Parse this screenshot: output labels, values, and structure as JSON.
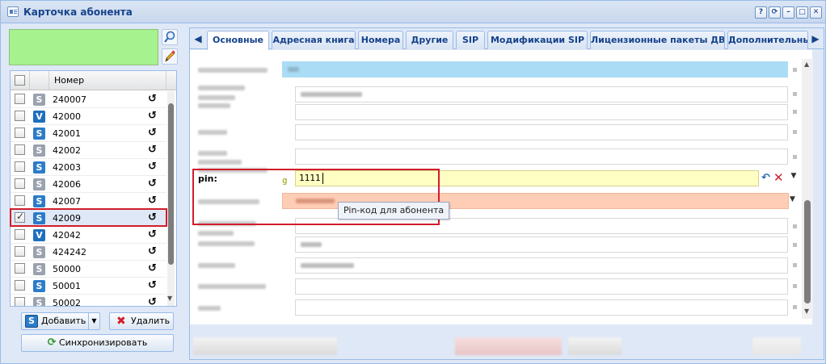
{
  "window": {
    "title": "Карточка абонента",
    "tools": [
      "?",
      "⟳",
      "–",
      "□",
      "✕"
    ]
  },
  "grid": {
    "header": "Номер",
    "rows": [
      {
        "type": "S",
        "number": "240007",
        "checked": false,
        "selected": false
      },
      {
        "type": "V",
        "number": "42000",
        "checked": false,
        "selected": false
      },
      {
        "type": "Sb",
        "number": "42001",
        "checked": false,
        "selected": false
      },
      {
        "type": "S",
        "number": "42002",
        "checked": false,
        "selected": false
      },
      {
        "type": "Sb",
        "number": "42003",
        "checked": false,
        "selected": false
      },
      {
        "type": "S",
        "number": "42006",
        "checked": false,
        "selected": false
      },
      {
        "type": "Sb",
        "number": "42007",
        "checked": false,
        "selected": false
      },
      {
        "type": "Sb",
        "number": "42009",
        "checked": true,
        "selected": true
      },
      {
        "type": "V",
        "number": "42042",
        "checked": false,
        "selected": false
      },
      {
        "type": "S",
        "number": "424242",
        "checked": false,
        "selected": false
      },
      {
        "type": "S",
        "number": "50000",
        "checked": false,
        "selected": false
      },
      {
        "type": "Sb",
        "number": "50001",
        "checked": false,
        "selected": false
      },
      {
        "type": "S",
        "number": "50002",
        "checked": false,
        "selected": false
      }
    ],
    "badge_letters": {
      "S": "S",
      "Sb": "S",
      "V": "V"
    }
  },
  "buttons": {
    "add": "Добавить",
    "delete": "Удалить",
    "sync": "Синхронизировать"
  },
  "tabs": [
    "Основные",
    "Адресная книга",
    "Номера",
    "Другие",
    "SIP",
    "Модификации SIP",
    "Лицензионные пакеты ДВО",
    "Дополнительны"
  ],
  "pin": {
    "label": "pin:",
    "prefix": "g",
    "value": "1111",
    "tooltip": "Pin-код для абонента"
  },
  "colors": {
    "selected_row": "#dfe8f6",
    "highlight_box": "#d11d2b",
    "pin_field": "#ffffc4",
    "salmon_field": "#ffcdb5",
    "top_field": "#aadcf5",
    "green_panel": "#a6f28f"
  },
  "icons": {
    "search": "search-icon",
    "edit": "pencil-icon",
    "history": "history-icon",
    "sync": "refresh-icon",
    "delete": "delete-icon"
  }
}
